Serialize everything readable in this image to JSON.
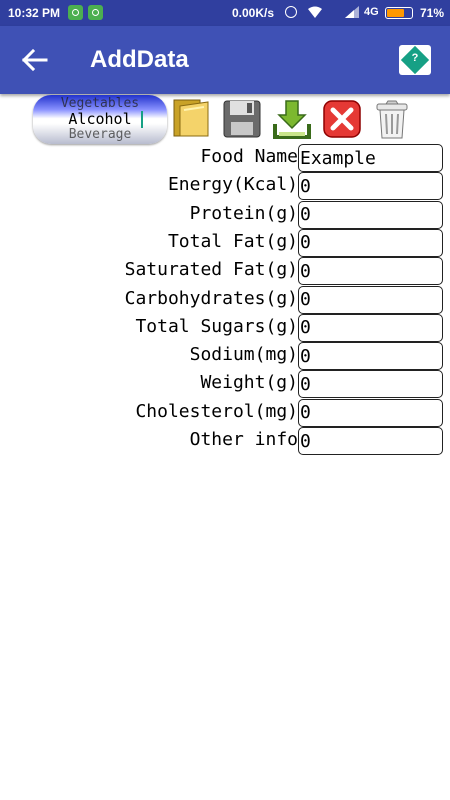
{
  "status_bar": {
    "time": "10:32 PM",
    "network_speed": "0.00K/s",
    "network_type": "4G",
    "battery_percent": "71%",
    "battery_level": 0.71,
    "battery_color": "#FF9800",
    "icons": [
      "app-notification-icon",
      "lock-app-icon",
      "alarm-icon",
      "wifi-icon",
      "signal-icon",
      "battery-icon"
    ]
  },
  "app_bar": {
    "title": "AddData",
    "back_icon": "arrow-back-icon",
    "help_icon": "help-icon",
    "help_glyph": "?",
    "background": "#3F51B5"
  },
  "category_picker": {
    "previous": "Vegetables",
    "selected": "Alcohol",
    "next": "Beverage"
  },
  "toolbar": {
    "buttons": [
      "open-folder-icon",
      "save-icon",
      "download-icon",
      "cancel-icon",
      "delete-icon"
    ]
  },
  "form": {
    "fields": [
      {
        "label": "Food Name",
        "value": "Example"
      },
      {
        "label": "Energy(Kcal)",
        "value": "0"
      },
      {
        "label": "Protein(g)",
        "value": "0"
      },
      {
        "label": "Total Fat(g)",
        "value": "0"
      },
      {
        "label": "Saturated Fat(g)",
        "value": "0"
      },
      {
        "label": "Carbohydrates(g)",
        "value": "0"
      },
      {
        "label": "Total Sugars(g)",
        "value": "0"
      },
      {
        "label": "Sodium(mg)",
        "value": "0"
      },
      {
        "label": "Weight(g)",
        "value": "0"
      },
      {
        "label": "Cholesterol(mg)",
        "value": "0"
      },
      {
        "label": "Other info",
        "value": "0"
      }
    ]
  }
}
